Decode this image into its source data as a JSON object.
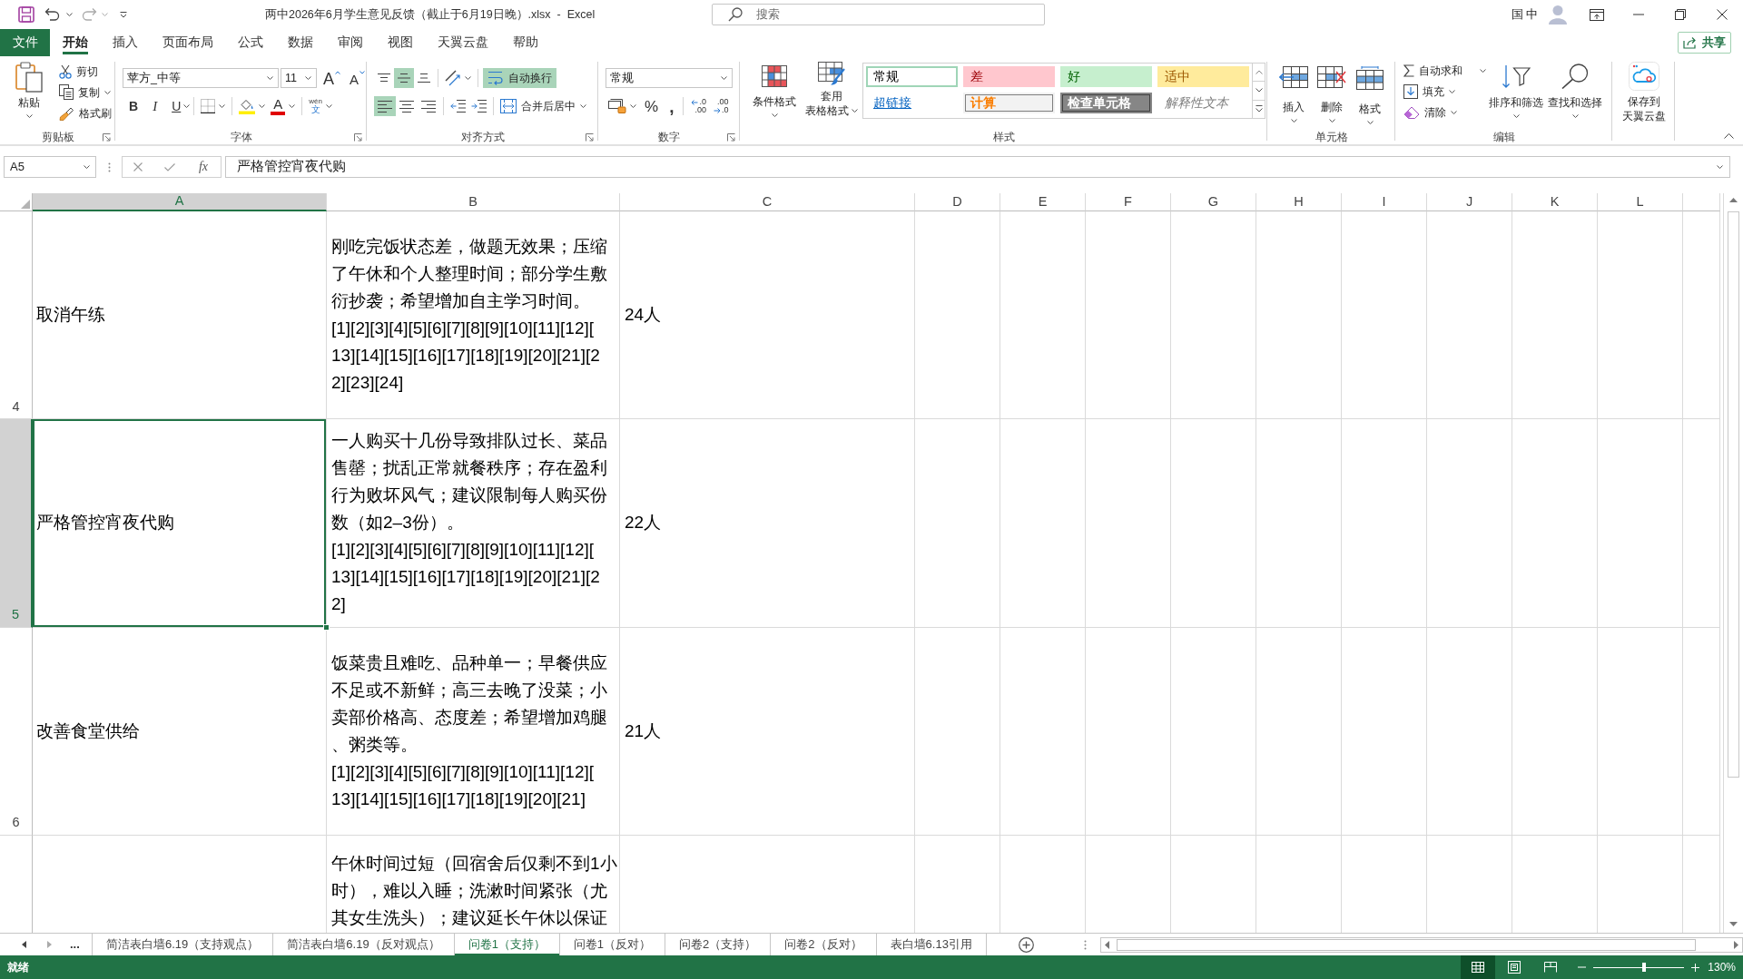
{
  "title_bar": {
    "title": "两中2026年6月学生意见反馈（截止于6月19日晚）.xlsx  -  Excel",
    "search_placeholder": "搜索",
    "input_method": "国 中"
  },
  "ribbon_tabs": [
    {
      "label": "文件",
      "kind": "file",
      "selected": false
    },
    {
      "label": "开始",
      "kind": "tab",
      "selected": true
    },
    {
      "label": "插入",
      "kind": "tab",
      "selected": false
    },
    {
      "label": "页面布局",
      "kind": "tab",
      "selected": false
    },
    {
      "label": "公式",
      "kind": "tab",
      "selected": false
    },
    {
      "label": "数据",
      "kind": "tab",
      "selected": false
    },
    {
      "label": "审阅",
      "kind": "tab",
      "selected": false
    },
    {
      "label": "视图",
      "kind": "tab",
      "selected": false
    },
    {
      "label": "天翼云盘",
      "kind": "tab",
      "selected": false
    },
    {
      "label": "帮助",
      "kind": "tab",
      "selected": false
    }
  ],
  "share_button": {
    "label": "共享"
  },
  "ribbon": {
    "clipboard": {
      "label": "剪贴板",
      "paste": "粘贴",
      "commands": [
        {
          "kind": "cut",
          "label": "剪切",
          "dropdown": false
        },
        {
          "kind": "copy",
          "label": "复制",
          "dropdown": true
        },
        {
          "kind": "format_painter",
          "label": "格式刷",
          "dropdown": false
        }
      ]
    },
    "font": {
      "label": "字体",
      "font_name": "苹方_中等",
      "font_size": "11",
      "size_buttons": [
        {
          "kind": "grow",
          "label": "A"
        },
        {
          "kind": "shrink",
          "label": "A"
        }
      ],
      "style_buttons": [
        {
          "kind": "bold",
          "label": "B",
          "on": false
        },
        {
          "kind": "italic",
          "label": "I",
          "on": false
        },
        {
          "kind": "underline",
          "label": "U",
          "on": false
        }
      ],
      "font_color": {
        "label": "A"
      },
      "phonetic": {
        "top": "wén",
        "bottom": "文"
      }
    },
    "alignment": {
      "label": "对齐方式",
      "vertical": [
        {
          "kind": "top",
          "selected": false
        },
        {
          "kind": "middle",
          "selected": true
        },
        {
          "kind": "bottom",
          "selected": false
        }
      ],
      "horizontal": [
        {
          "kind": "left",
          "selected": true
        },
        {
          "kind": "center",
          "selected": false
        },
        {
          "kind": "right",
          "selected": false
        }
      ],
      "wrap_text": {
        "label": "自动换行",
        "on": true
      },
      "merge": "合并后居中"
    },
    "number": {
      "label": "数字",
      "format": "常规",
      "symbols": [
        {
          "kind": "percent",
          "label": "%"
        },
        {
          "kind": "comma",
          "label": ","
        }
      ],
      "decimals": [
        {
          "kind": "increase",
          "top": ".0",
          "bottom": ".00"
        },
        {
          "kind": "decrease",
          "top": ".00",
          "bottom": ".0"
        }
      ]
    },
    "styles": {
      "label": "样式",
      "conditional": "条件格式",
      "table_format": [
        "套用",
        "表格格式"
      ],
      "gallery": [
        {
          "label": "常规",
          "kind": "normal",
          "selected": true
        },
        {
          "label": "差",
          "kind": "bad",
          "selected": false
        },
        {
          "label": "好",
          "kind": "good",
          "selected": false
        },
        {
          "label": "适中",
          "kind": "neutral",
          "selected": false
        },
        {
          "label": "超链接",
          "kind": "hyperlink",
          "selected": false
        },
        {
          "label": "计算",
          "kind": "calculation",
          "selected": false
        },
        {
          "label": "检查单元格",
          "kind": "check_cell",
          "selected": false
        },
        {
          "label": "解释性文本",
          "kind": "explanatory",
          "selected": false
        }
      ]
    },
    "cells": {
      "label": "单元格",
      "commands": [
        {
          "kind": "insert",
          "label": "插入"
        },
        {
          "kind": "delete",
          "label": "删除"
        },
        {
          "kind": "format",
          "label": "格式"
        }
      ]
    },
    "editing": {
      "label": "编辑",
      "small": [
        {
          "kind": "autosum",
          "label": "自动求和"
        },
        {
          "kind": "fill",
          "label": "填充"
        },
        {
          "kind": "clear",
          "label": "清除"
        }
      ],
      "large": [
        {
          "kind": "sort",
          "label": "排序和筛选"
        },
        {
          "kind": "find",
          "label": "查找和选择"
        }
      ]
    },
    "cloud": {
      "lines": [
        "保存到",
        "天翼云盘"
      ]
    }
  },
  "formula_bar": {
    "name_box": "A5",
    "function_label": "fx",
    "formula": "严格管控宵夜代购"
  },
  "sheet": {
    "columns": [
      {
        "label": "A",
        "selected": true
      },
      {
        "label": "B",
        "selected": false
      },
      {
        "label": "C",
        "selected": false
      },
      {
        "label": "D",
        "selected": false
      },
      {
        "label": "E",
        "selected": false
      },
      {
        "label": "F",
        "selected": false
      },
      {
        "label": "G",
        "selected": false
      },
      {
        "label": "H",
        "selected": false
      },
      {
        "label": "I",
        "selected": false
      },
      {
        "label": "J",
        "selected": false
      },
      {
        "label": "K",
        "selected": false
      },
      {
        "label": "L",
        "selected": false
      }
    ],
    "rows": [
      {
        "number": "4",
        "selected": false,
        "a": "取消午练",
        "b": [
          "刚吃完饭状态差，做题无效果；压缩",
          "了午休和个人整理时间；部分学生敷",
          "衍抄袭；希望增加自主学习时间。",
          "[1][2][3][4][5][6][7][8][9][10][11][12][",
          "13][14][15][16][17][18][19][20][21][2",
          "2][23][24]"
        ],
        "c": "24人"
      },
      {
        "number": "5",
        "selected": true,
        "a": "严格管控宵夜代购",
        "b": [
          "一人购买十几份导致排队过长、菜品",
          "售罄；扰乱正常就餐秩序；存在盈利",
          "行为败坏风气；建议限制每人购买份",
          "数（如2–3份）。",
          "[1][2][3][4][5][6][7][8][9][10][11][12][",
          "13][14][15][16][17][18][19][20][21][2",
          "2]"
        ],
        "c": "22人"
      },
      {
        "number": "6",
        "selected": false,
        "a": "改善食堂供给",
        "b": [
          "饭菜贵且难吃、品种单一；早餐供应",
          "不足或不新鲜；高三去晚了没菜；小",
          "卖部价格高、态度差；希望增加鸡腿",
          "、粥类等。",
          "[1][2][3][4][5][6][7][8][9][10][11][12][",
          "13][14][15][16][17][18][19][20][21]"
        ],
        "c": "21人"
      },
      {
        "selected": false,
        "b": [
          "午休时间过短（回宿舍后仅剩不到1小",
          "时），难以入睡；洗漱时间紧张（尤",
          "其女生洗头）；建议延长午休以保证"
        ]
      }
    ]
  },
  "sheet_tabs": {
    "overflow": "...",
    "tabs": [
      {
        "label": "简洁表白墙6.19（支持观点）",
        "selected": false
      },
      {
        "label": "简洁表白墙6.19（反对观点）",
        "selected": false
      },
      {
        "label": "问卷1（支持）",
        "selected": true
      },
      {
        "label": "问卷1（反对）",
        "selected": false
      },
      {
        "label": "问卷2（支持）",
        "selected": false
      },
      {
        "label": "问卷2（反对）",
        "selected": false
      },
      {
        "label": "表白墙6.13引用",
        "selected": false
      }
    ]
  },
  "status_bar": {
    "status": "就绪",
    "views": [
      {
        "kind": "normal",
        "selected": true
      },
      {
        "kind": "page_layout",
        "selected": false
      },
      {
        "kind": "page_break",
        "selected": false
      }
    ],
    "zoom_slider": {
      "level": 0.56
    },
    "zoom": "130%"
  }
}
